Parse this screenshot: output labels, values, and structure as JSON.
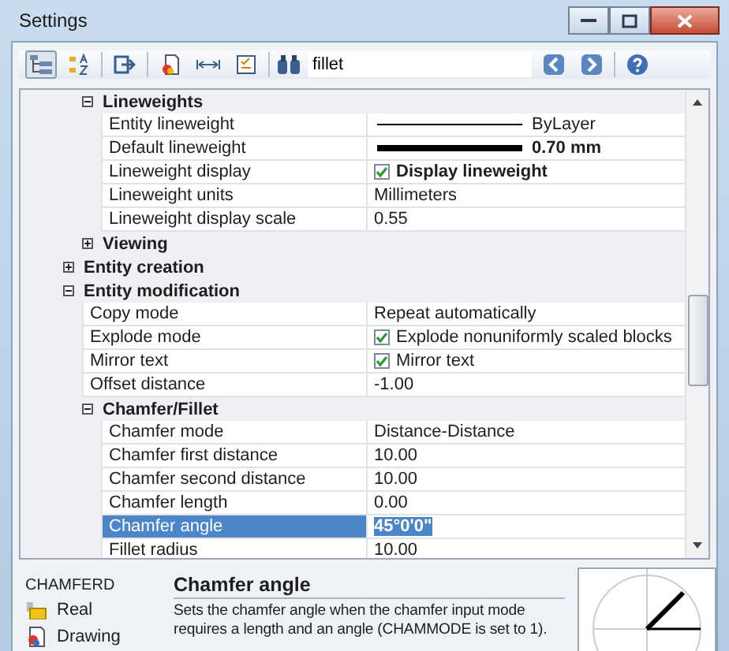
{
  "window": {
    "title": "Settings"
  },
  "search": {
    "value": "fillet"
  },
  "tree": [
    {
      "children": [
        {
          "label": "Lineweights",
          "expanded": true,
          "children": [
            {
              "kind": "line",
              "name": "Entity lineweight",
              "value": "ByLayer",
              "emphasized": false,
              "selected": false
            },
            {
              "kind": "line",
              "name": "Default lineweight",
              "value": "0.70 mm",
              "emphasized": true,
              "selected": false
            },
            {
              "kind": "checkbox",
              "name": "Lineweight display",
              "value": "Display lineweight",
              "checked": true,
              "emphasized": true,
              "selected": false
            },
            {
              "kind": "text",
              "name": "Lineweight units",
              "value": "Millimeters",
              "emphasized": false,
              "selected": false
            },
            {
              "kind": "text",
              "name": "Lineweight display scale",
              "value": "0.55",
              "emphasized": false,
              "selected": false
            }
          ]
        },
        {
          "label": "Viewing",
          "expanded": false
        }
      ]
    },
    {
      "label": "Entity creation",
      "expanded": false
    },
    {
      "label": "Entity modification",
      "expanded": true,
      "children": [
        {
          "kind": "text",
          "name": "Copy mode",
          "value": "Repeat automatically",
          "emphasized": false,
          "selected": false
        },
        {
          "kind": "checkbox",
          "name": "Explode mode",
          "value": "Explode nonuniformly scaled blocks",
          "checked": true,
          "emphasized": false,
          "selected": false
        },
        {
          "kind": "checkbox",
          "name": "Mirror text",
          "value": "Mirror text",
          "checked": true,
          "emphasized": false,
          "selected": false
        },
        {
          "kind": "text",
          "name": "Offset distance",
          "value": "-1.00",
          "emphasized": false,
          "selected": false
        },
        {
          "label": "Chamfer/Fillet",
          "expanded": true,
          "children": [
            {
              "kind": "text",
              "name": "Chamfer mode",
              "value": "Distance-Distance",
              "emphasized": false,
              "selected": false
            },
            {
              "kind": "text",
              "name": "Chamfer first distance",
              "value": "10.00",
              "emphasized": false,
              "selected": false
            },
            {
              "kind": "text",
              "name": "Chamfer second distance",
              "value": "10.00",
              "emphasized": false,
              "selected": false
            },
            {
              "kind": "text",
              "name": "Chamfer length",
              "value": "0.00",
              "emphasized": false,
              "selected": false
            },
            {
              "kind": "text",
              "name": "Chamfer angle",
              "value": "45°0'0\"",
              "emphasized": true,
              "selected": true
            },
            {
              "kind": "text",
              "name": "Fillet radius",
              "value": "10.00",
              "emphasized": false,
              "selected": false
            }
          ]
        }
      ]
    }
  ],
  "info": {
    "variable": "CHAMFERD",
    "type": "Real",
    "scope": "Drawing",
    "title": "Chamfer angle",
    "description": "Sets the chamfer angle when the chamfer input mode requires a length and an angle (CHAMMODE is set to 1)."
  }
}
